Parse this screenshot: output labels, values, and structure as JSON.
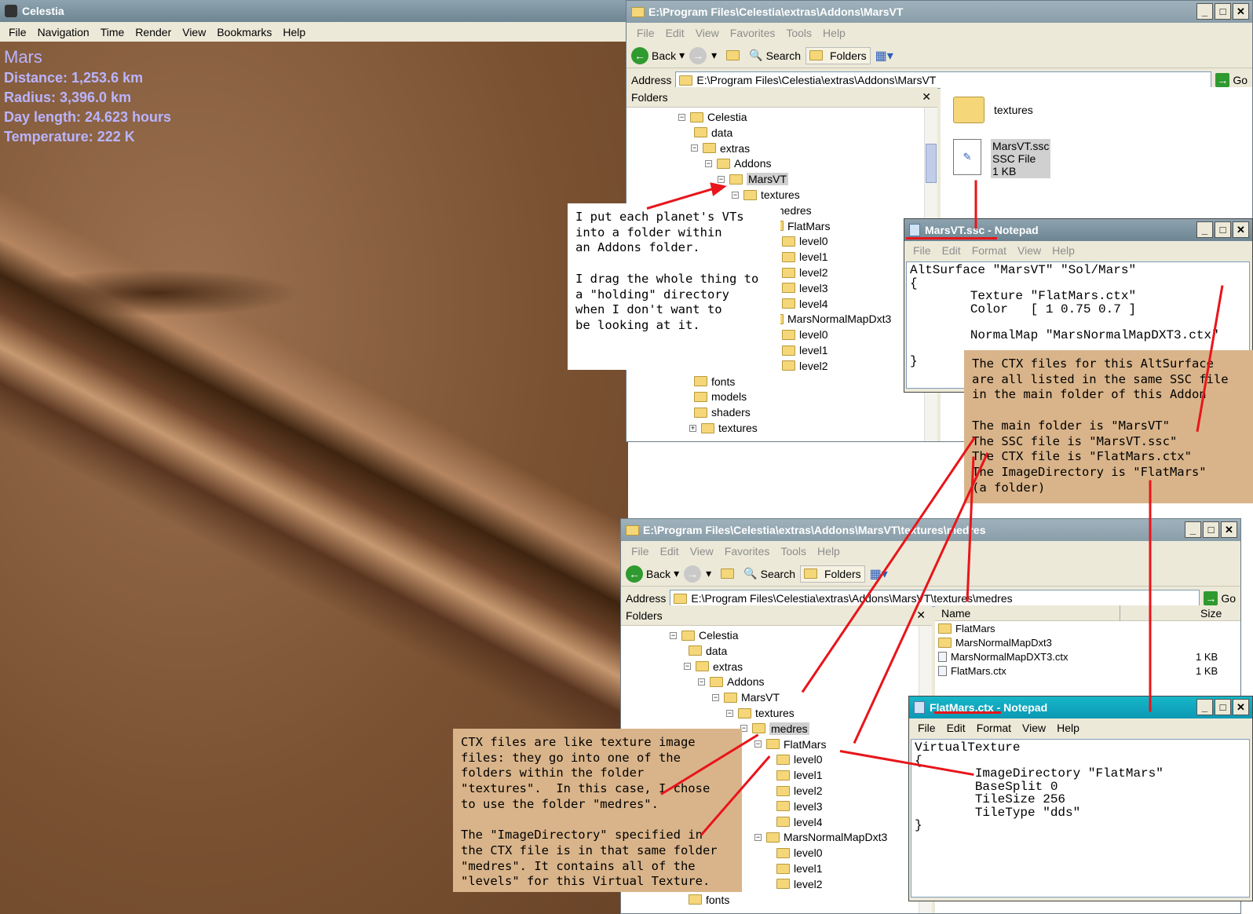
{
  "celestia": {
    "title": "Celestia",
    "menu": [
      "File",
      "Navigation",
      "Time",
      "Render",
      "View",
      "Bookmarks",
      "Help"
    ],
    "info": {
      "object": "Mars",
      "distance": "Distance: 1,253.6 km",
      "radius": "Radius: 3,396.0 km",
      "day": "Day length: 24.623 hours",
      "temp": "Temperature: 222 K"
    }
  },
  "explorer1": {
    "title": "E:\\Program Files\\Celestia\\extras\\Addons\\MarsVT",
    "menu": [
      "File",
      "Edit",
      "View",
      "Favorites",
      "Tools",
      "Help"
    ],
    "back": "Back",
    "search": "Search",
    "folders": "Folders",
    "address_label": "Address",
    "address": "E:\\Program Files\\Celestia\\extras\\Addons\\MarsVT",
    "go": "Go",
    "folders_header": "Folders",
    "tree": [
      "Celestia",
      "data",
      "extras",
      "Addons",
      "MarsVT",
      "textures",
      "medres",
      "FlatMars",
      "level0",
      "level1",
      "level2",
      "level3",
      "level4",
      "MarsNormalMapDxt3",
      "level0",
      "level1",
      "level2",
      "fonts",
      "models",
      "shaders",
      "textures"
    ],
    "files": {
      "folder": "textures",
      "file_name": "MarsVT.ssc",
      "file_type": "SSC File",
      "file_size": "1 KB"
    }
  },
  "notepad1": {
    "title": "MarsVT.ssc - Notepad",
    "menu": [
      "File",
      "Edit",
      "Format",
      "View",
      "Help"
    ],
    "text": "AltSurface \"MarsVT\" \"Sol/Mars\"\n{\n        Texture \"FlatMars.ctx\"\n        Color   [ 1 0.75 0.7 ]\n\n        NormalMap \"MarsNormalMapDXT3.ctx\"\n\n}"
  },
  "explorer2": {
    "title": "E:\\Program Files\\Celestia\\extras\\Addons\\MarsVT\\textures\\medres",
    "menu": [
      "File",
      "Edit",
      "View",
      "Favorites",
      "Tools",
      "Help"
    ],
    "back": "Back",
    "search": "Search",
    "folders": "Folders",
    "address_label": "Address",
    "address": "E:\\Program Files\\Celestia\\extras\\Addons\\MarsVT\\textures\\medres",
    "go": "Go",
    "folders_header": "Folders",
    "tree": [
      "Celestia",
      "data",
      "extras",
      "Addons",
      "MarsVT",
      "textures",
      "medres",
      "FlatMars",
      "level0",
      "level1",
      "level2",
      "level3",
      "level4",
      "MarsNormalMapDxt3",
      "level0",
      "level1",
      "level2",
      "fonts"
    ],
    "col_name": "Name",
    "col_size": "Size",
    "files": [
      {
        "name": "FlatMars",
        "size": ""
      },
      {
        "name": "MarsNormalMapDxt3",
        "size": ""
      },
      {
        "name": "MarsNormalMapDXT3.ctx",
        "size": "1 KB"
      },
      {
        "name": "FlatMars.ctx",
        "size": "1 KB"
      }
    ]
  },
  "notepad2": {
    "title": "FlatMars.ctx - Notepad",
    "menu": [
      "File",
      "Edit",
      "Format",
      "View",
      "Help"
    ],
    "text": "VirtualTexture\n{\n        ImageDirectory \"FlatMars\"\n        BaseSplit 0\n        TileSize 256\n        TileType \"dds\"\n}"
  },
  "notes": {
    "n1": "I put each planet's VTs\ninto a folder within\nan Addons folder.\n\nI drag the whole thing to\na \"holding\" directory\nwhen I don't want to\nbe looking at it.",
    "n2": "The CTX files for this AltSurface\nare all listed in the same SSC file\nin the main folder of this Addon\n\nThe main folder is \"MarsVT\"\nThe SSC file is \"MarsVT.ssc\"\nThe CTX file is \"FlatMars.ctx\"\nThe ImageDirectory is \"FlatMars\"\n(a folder)",
    "n3": "CTX files are like texture image\nfiles: they go into one of the\nfolders within the folder\n\"textures\".  In this case, I chose\nto use the folder \"medres\".\n\nThe \"ImageDirectory\" specified in\nthe CTX file is in that same folder\n\"medres\". It contains all of the\n\"levels\" for this Virtual Texture."
  },
  "colors": {
    "annotation": "#e8151a",
    "note_tan": "#d9b48a"
  }
}
